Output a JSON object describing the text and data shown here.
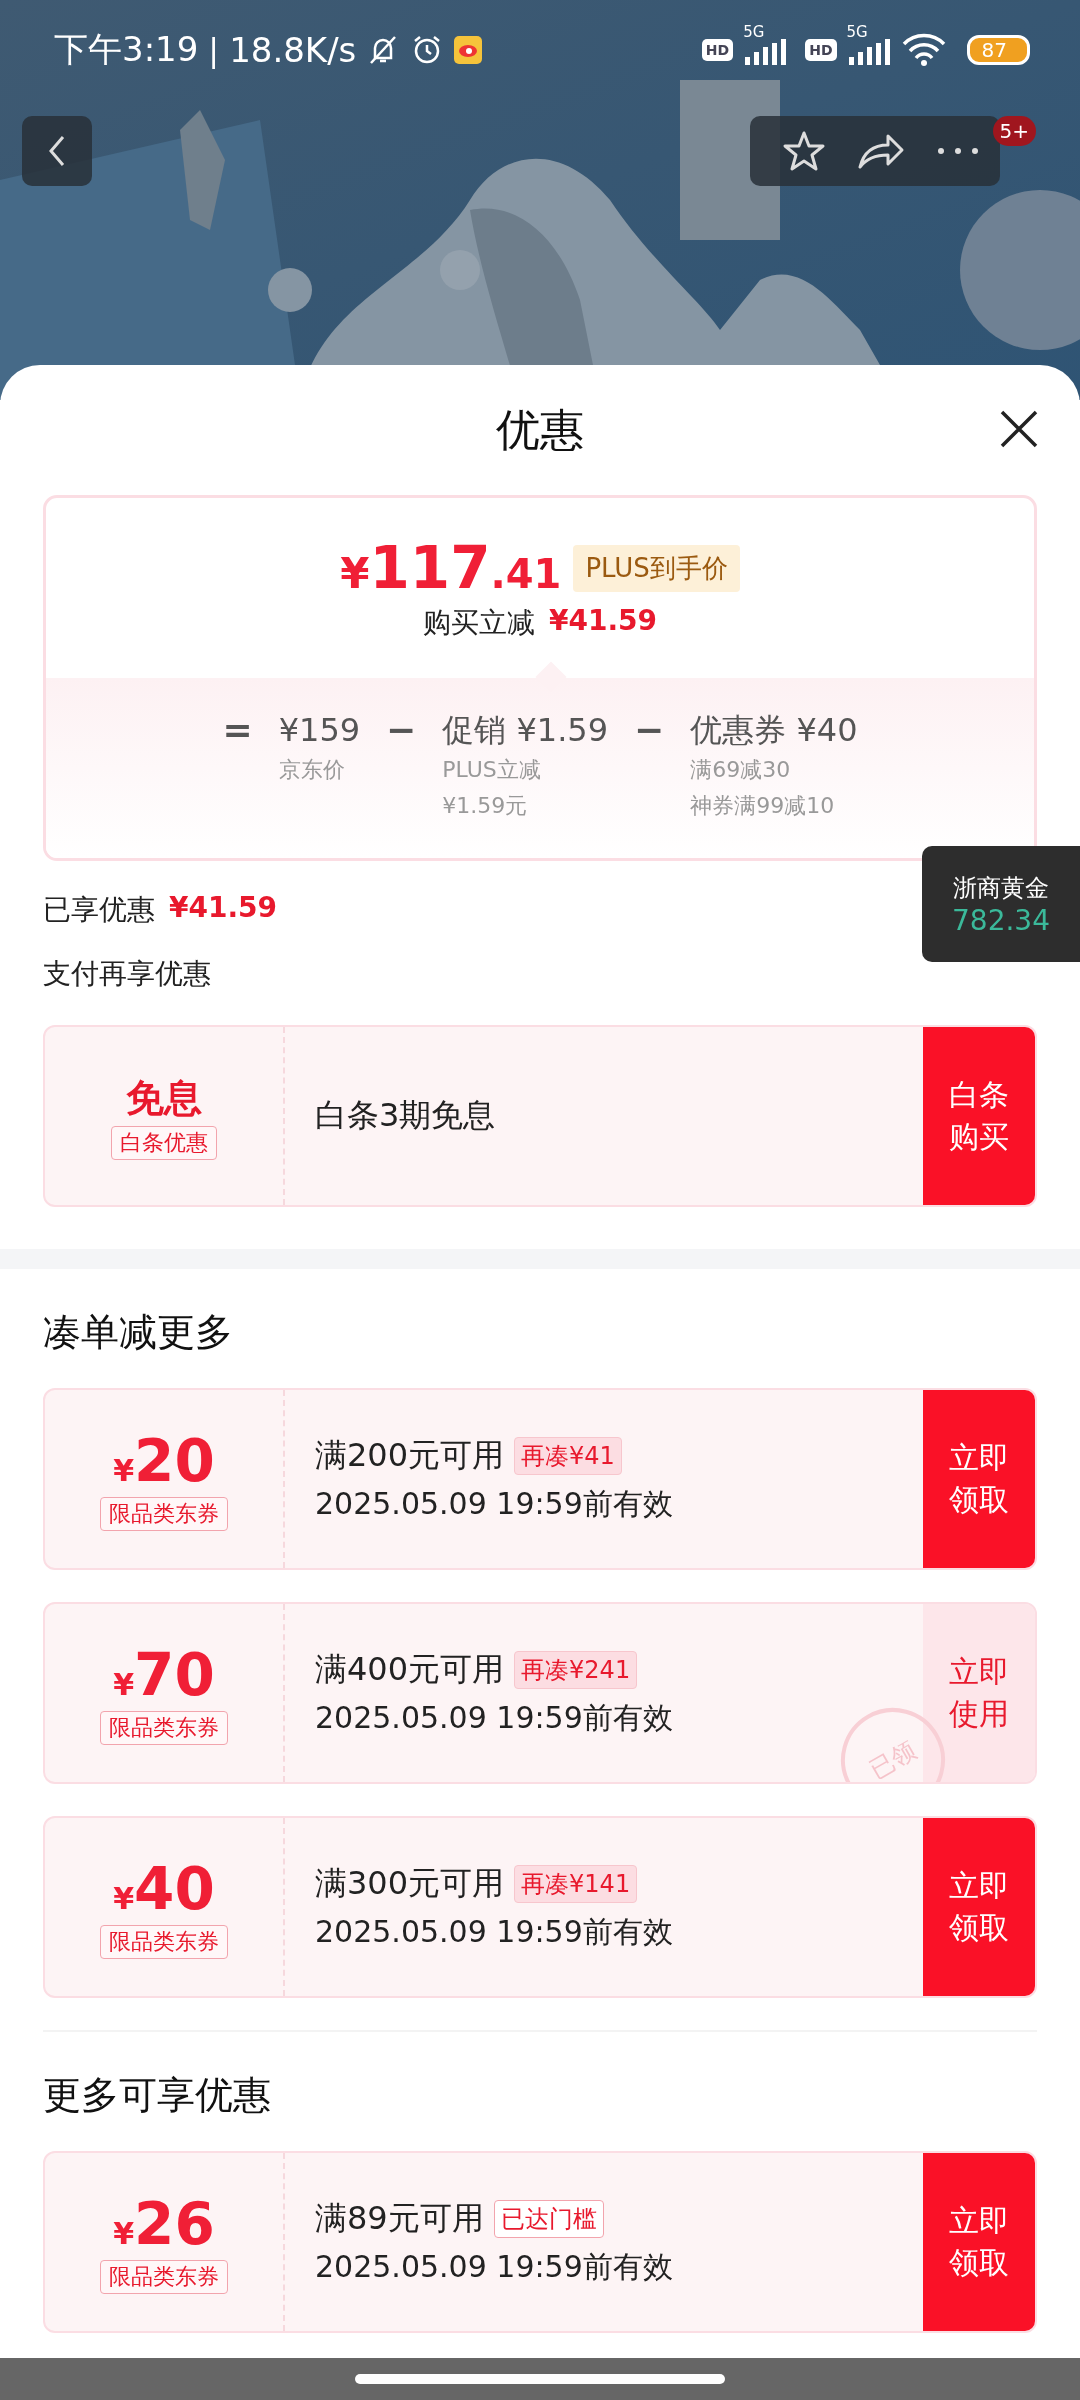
{
  "status_bar": {
    "time": "下午3:19",
    "separator": "|",
    "speed": "18.8K/s",
    "sims": [
      {
        "hd": "HD",
        "network": "5G"
      },
      {
        "hd": "HD",
        "network": "5G"
      }
    ],
    "battery": "87"
  },
  "header": {
    "badge": "5+"
  },
  "sheet": {
    "title": "优惠"
  },
  "price": {
    "currency": "¥",
    "integer": "117",
    "decimal": ".41",
    "tag": "PLUS到手价",
    "saving_label": "购买立减",
    "saving": "¥41.59"
  },
  "breakdown": [
    {
      "sign": "=",
      "amount": "¥159",
      "notes": [
        "京东价"
      ]
    },
    {
      "sign": "−",
      "name": "促销",
      "amount": "¥1.59",
      "notes": [
        "PLUS立减",
        "¥1.59元"
      ]
    },
    {
      "sign": "−",
      "name": "优惠券",
      "amount": "¥40",
      "notes": [
        "满69减30",
        "神券满99减10"
      ]
    }
  ],
  "enjoyed": {
    "label": "已享优惠",
    "amount": "¥41.59"
  },
  "pay_heading": "支付再享优惠",
  "baitiao": {
    "title": "免息",
    "tag": "白条优惠",
    "desc": "白条3期免息",
    "action": "白条购买"
  },
  "floating_widget": {
    "name": "浙商黄金",
    "value": "782.34"
  },
  "sections": [
    {
      "title": "凑单减更多",
      "coupons": [
        {
          "currency": "¥",
          "amount": "20",
          "type": "限品类东券",
          "condition": "满200元可用",
          "hint": "再凑¥41",
          "kind": "gap",
          "validity": "2025.05.09 19:59前有效",
          "action": "立即领取",
          "claimed": false
        },
        {
          "currency": "¥",
          "amount": "70",
          "type": "限品类东券",
          "condition": "满400元可用",
          "hint": "再凑¥241",
          "kind": "gap",
          "validity": "2025.05.09 19:59前有效",
          "action": "立即使用",
          "claimed": true,
          "stamp": "已领"
        },
        {
          "currency": "¥",
          "amount": "40",
          "type": "限品类东券",
          "condition": "满300元可用",
          "hint": "再凑¥141",
          "kind": "gap",
          "validity": "2025.05.09 19:59前有效",
          "action": "立即领取",
          "claimed": false
        }
      ]
    },
    {
      "title": "更多可享优惠",
      "coupons": [
        {
          "currency": "¥",
          "amount": "26",
          "type": "限品类东券",
          "condition": "满89元可用",
          "hint": "已达门槛",
          "kind": "reached",
          "validity": "2025.05.09 19:59前有效",
          "action": "立即领取",
          "claimed": false
        }
      ]
    }
  ]
}
